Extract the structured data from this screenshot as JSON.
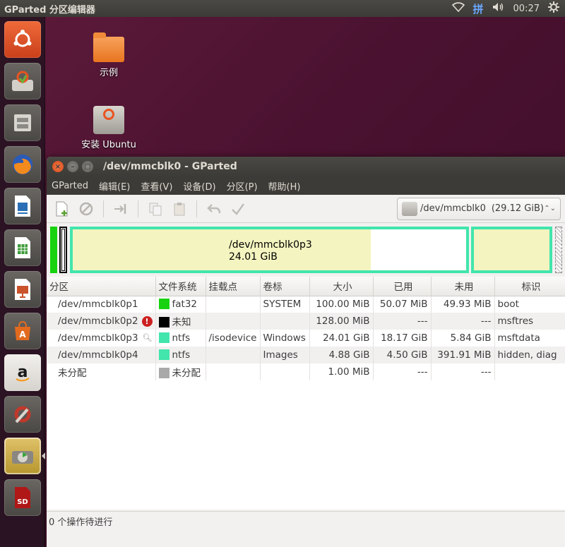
{
  "top_panel": {
    "app_title": "GParted 分区编辑器",
    "ime_label": "拼",
    "clock": "00:27"
  },
  "desktop": {
    "icons": [
      {
        "label": "示例"
      },
      {
        "label": "安装 Ubuntu"
      }
    ]
  },
  "launcher": {
    "items": [
      {
        "name": "ubuntu-dash",
        "color": "#e95420"
      },
      {
        "name": "install-ubuntu",
        "color": "#c9c6c0"
      },
      {
        "name": "file-manager",
        "color": "#8c8a85"
      },
      {
        "name": "firefox",
        "color": "#e66000"
      },
      {
        "name": "libreoffice-writer",
        "color": "#2a6fb5"
      },
      {
        "name": "libreoffice-calc",
        "color": "#3e9b3a"
      },
      {
        "name": "libreoffice-impress",
        "color": "#c9532a"
      },
      {
        "name": "ubuntu-software",
        "color": "#e26a1e"
      },
      {
        "name": "amazon",
        "color": "#e7e4df"
      },
      {
        "name": "system-settings",
        "color": "#b33a2f"
      },
      {
        "name": "gparted",
        "color": "#c3a33a"
      },
      {
        "name": "sd-card",
        "color": "#b01717"
      }
    ]
  },
  "window": {
    "title": "/dev/mmcblk0 - GParted",
    "menu": [
      "GParted",
      "编辑(E)",
      "查看(V)",
      "设备(D)",
      "分区(P)",
      "帮助(H)"
    ],
    "device_selector": {
      "device": "/dev/mmcblk0",
      "size": "(29.12 GiB)"
    },
    "diskmap": {
      "selected_label": "/dev/mmcblk0p3",
      "selected_size": "24.01 GiB"
    },
    "columns": [
      "分区",
      "文件系统",
      "挂载点",
      "卷标",
      "大小",
      "已用",
      "未用",
      "标识"
    ],
    "rows": [
      {
        "partition": "/dev/mmcblk0p1",
        "fs": "fat32",
        "fs_color": "#18d20f",
        "mount": "",
        "label": "SYSTEM",
        "size": "100.00 MiB",
        "used": "50.07 MiB",
        "unused": "49.93 MiB",
        "flags": "boot",
        "icon": ""
      },
      {
        "partition": "/dev/mmcblk0p2",
        "fs": "未知",
        "fs_color": "#000000",
        "mount": "",
        "label": "",
        "size": "128.00 MiB",
        "used": "---",
        "unused": "---",
        "flags": "msftres",
        "icon": "warning"
      },
      {
        "partition": "/dev/mmcblk0p3",
        "fs": "ntfs",
        "fs_color": "#42e5ac",
        "mount": "/isodevice",
        "label": "Windows",
        "size": "24.01 GiB",
        "used": "18.17 GiB",
        "unused": "5.84 GiB",
        "flags": "msftdata",
        "icon": "key"
      },
      {
        "partition": "/dev/mmcblk0p4",
        "fs": "ntfs",
        "fs_color": "#42e5ac",
        "mount": "",
        "label": "Images",
        "size": "4.88 GiB",
        "used": "4.50 GiB",
        "unused": "391.91 MiB",
        "flags": "hidden, diag",
        "icon": ""
      },
      {
        "partition": "未分配",
        "fs": "未分配",
        "fs_color": "#a9a9a9",
        "mount": "",
        "label": "",
        "size": "1.00 MiB",
        "used": "---",
        "unused": "---",
        "flags": "",
        "icon": ""
      }
    ],
    "status": "0 个操作待进行"
  }
}
